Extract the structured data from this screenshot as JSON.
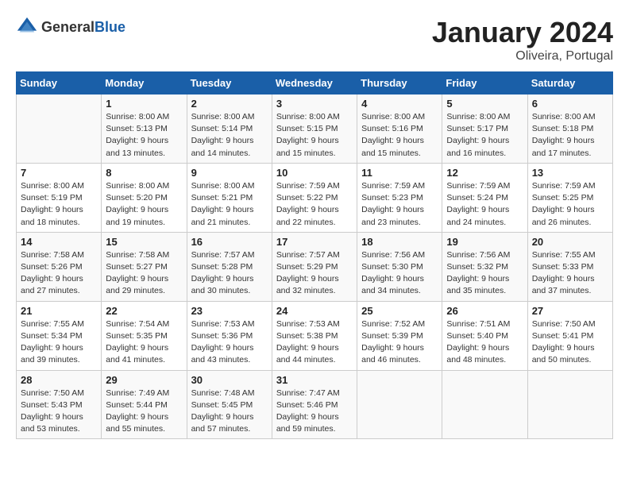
{
  "header": {
    "logo_general": "General",
    "logo_blue": "Blue",
    "month_title": "January 2024",
    "location": "Oliveira, Portugal"
  },
  "weekdays": [
    "Sunday",
    "Monday",
    "Tuesday",
    "Wednesday",
    "Thursday",
    "Friday",
    "Saturday"
  ],
  "weeks": [
    [
      {
        "day": "",
        "sunrise": "",
        "sunset": "",
        "daylight": ""
      },
      {
        "day": "1",
        "sunrise": "Sunrise: 8:00 AM",
        "sunset": "Sunset: 5:13 PM",
        "daylight": "Daylight: 9 hours and 13 minutes."
      },
      {
        "day": "2",
        "sunrise": "Sunrise: 8:00 AM",
        "sunset": "Sunset: 5:14 PM",
        "daylight": "Daylight: 9 hours and 14 minutes."
      },
      {
        "day": "3",
        "sunrise": "Sunrise: 8:00 AM",
        "sunset": "Sunset: 5:15 PM",
        "daylight": "Daylight: 9 hours and 15 minutes."
      },
      {
        "day": "4",
        "sunrise": "Sunrise: 8:00 AM",
        "sunset": "Sunset: 5:16 PM",
        "daylight": "Daylight: 9 hours and 15 minutes."
      },
      {
        "day": "5",
        "sunrise": "Sunrise: 8:00 AM",
        "sunset": "Sunset: 5:17 PM",
        "daylight": "Daylight: 9 hours and 16 minutes."
      },
      {
        "day": "6",
        "sunrise": "Sunrise: 8:00 AM",
        "sunset": "Sunset: 5:18 PM",
        "daylight": "Daylight: 9 hours and 17 minutes."
      }
    ],
    [
      {
        "day": "7",
        "sunrise": "Sunrise: 8:00 AM",
        "sunset": "Sunset: 5:19 PM",
        "daylight": "Daylight: 9 hours and 18 minutes."
      },
      {
        "day": "8",
        "sunrise": "Sunrise: 8:00 AM",
        "sunset": "Sunset: 5:20 PM",
        "daylight": "Daylight: 9 hours and 19 minutes."
      },
      {
        "day": "9",
        "sunrise": "Sunrise: 8:00 AM",
        "sunset": "Sunset: 5:21 PM",
        "daylight": "Daylight: 9 hours and 21 minutes."
      },
      {
        "day": "10",
        "sunrise": "Sunrise: 7:59 AM",
        "sunset": "Sunset: 5:22 PM",
        "daylight": "Daylight: 9 hours and 22 minutes."
      },
      {
        "day": "11",
        "sunrise": "Sunrise: 7:59 AM",
        "sunset": "Sunset: 5:23 PM",
        "daylight": "Daylight: 9 hours and 23 minutes."
      },
      {
        "day": "12",
        "sunrise": "Sunrise: 7:59 AM",
        "sunset": "Sunset: 5:24 PM",
        "daylight": "Daylight: 9 hours and 24 minutes."
      },
      {
        "day": "13",
        "sunrise": "Sunrise: 7:59 AM",
        "sunset": "Sunset: 5:25 PM",
        "daylight": "Daylight: 9 hours and 26 minutes."
      }
    ],
    [
      {
        "day": "14",
        "sunrise": "Sunrise: 7:58 AM",
        "sunset": "Sunset: 5:26 PM",
        "daylight": "Daylight: 9 hours and 27 minutes."
      },
      {
        "day": "15",
        "sunrise": "Sunrise: 7:58 AM",
        "sunset": "Sunset: 5:27 PM",
        "daylight": "Daylight: 9 hours and 29 minutes."
      },
      {
        "day": "16",
        "sunrise": "Sunrise: 7:57 AM",
        "sunset": "Sunset: 5:28 PM",
        "daylight": "Daylight: 9 hours and 30 minutes."
      },
      {
        "day": "17",
        "sunrise": "Sunrise: 7:57 AM",
        "sunset": "Sunset: 5:29 PM",
        "daylight": "Daylight: 9 hours and 32 minutes."
      },
      {
        "day": "18",
        "sunrise": "Sunrise: 7:56 AM",
        "sunset": "Sunset: 5:30 PM",
        "daylight": "Daylight: 9 hours and 34 minutes."
      },
      {
        "day": "19",
        "sunrise": "Sunrise: 7:56 AM",
        "sunset": "Sunset: 5:32 PM",
        "daylight": "Daylight: 9 hours and 35 minutes."
      },
      {
        "day": "20",
        "sunrise": "Sunrise: 7:55 AM",
        "sunset": "Sunset: 5:33 PM",
        "daylight": "Daylight: 9 hours and 37 minutes."
      }
    ],
    [
      {
        "day": "21",
        "sunrise": "Sunrise: 7:55 AM",
        "sunset": "Sunset: 5:34 PM",
        "daylight": "Daylight: 9 hours and 39 minutes."
      },
      {
        "day": "22",
        "sunrise": "Sunrise: 7:54 AM",
        "sunset": "Sunset: 5:35 PM",
        "daylight": "Daylight: 9 hours and 41 minutes."
      },
      {
        "day": "23",
        "sunrise": "Sunrise: 7:53 AM",
        "sunset": "Sunset: 5:36 PM",
        "daylight": "Daylight: 9 hours and 43 minutes."
      },
      {
        "day": "24",
        "sunrise": "Sunrise: 7:53 AM",
        "sunset": "Sunset: 5:38 PM",
        "daylight": "Daylight: 9 hours and 44 minutes."
      },
      {
        "day": "25",
        "sunrise": "Sunrise: 7:52 AM",
        "sunset": "Sunset: 5:39 PM",
        "daylight": "Daylight: 9 hours and 46 minutes."
      },
      {
        "day": "26",
        "sunrise": "Sunrise: 7:51 AM",
        "sunset": "Sunset: 5:40 PM",
        "daylight": "Daylight: 9 hours and 48 minutes."
      },
      {
        "day": "27",
        "sunrise": "Sunrise: 7:50 AM",
        "sunset": "Sunset: 5:41 PM",
        "daylight": "Daylight: 9 hours and 50 minutes."
      }
    ],
    [
      {
        "day": "28",
        "sunrise": "Sunrise: 7:50 AM",
        "sunset": "Sunset: 5:43 PM",
        "daylight": "Daylight: 9 hours and 53 minutes."
      },
      {
        "day": "29",
        "sunrise": "Sunrise: 7:49 AM",
        "sunset": "Sunset: 5:44 PM",
        "daylight": "Daylight: 9 hours and 55 minutes."
      },
      {
        "day": "30",
        "sunrise": "Sunrise: 7:48 AM",
        "sunset": "Sunset: 5:45 PM",
        "daylight": "Daylight: 9 hours and 57 minutes."
      },
      {
        "day": "31",
        "sunrise": "Sunrise: 7:47 AM",
        "sunset": "Sunset: 5:46 PM",
        "daylight": "Daylight: 9 hours and 59 minutes."
      },
      {
        "day": "",
        "sunrise": "",
        "sunset": "",
        "daylight": ""
      },
      {
        "day": "",
        "sunrise": "",
        "sunset": "",
        "daylight": ""
      },
      {
        "day": "",
        "sunrise": "",
        "sunset": "",
        "daylight": ""
      }
    ]
  ]
}
